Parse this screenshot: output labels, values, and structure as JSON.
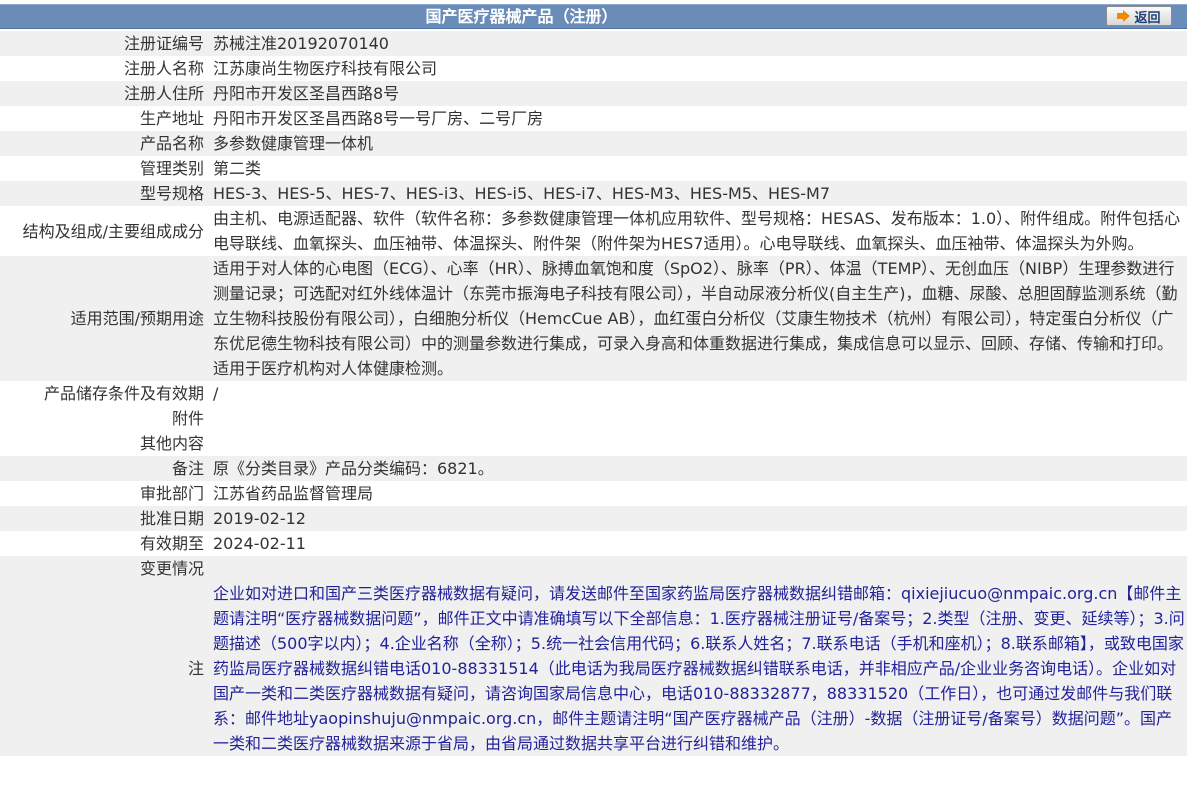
{
  "header": {
    "title": "国产医疗器械产品（注册）",
    "back_label": "返回"
  },
  "colors": {
    "title_bar": "#6a8cb8",
    "row_alt": "#f0f0f0",
    "back_arrow": "#f08a00",
    "note_text": "#22229a"
  },
  "rows": [
    {
      "label": "注册证编号",
      "value": "苏械注准20192070140"
    },
    {
      "label": "注册人名称",
      "value": "江苏康尚生物医疗科技有限公司"
    },
    {
      "label": "注册人住所",
      "value": "丹阳市开发区圣昌西路8号"
    },
    {
      "label": "生产地址",
      "value": "丹阳市开发区圣昌西路8号一号厂房、二号厂房"
    },
    {
      "label": "产品名称",
      "value": "多参数健康管理一体机"
    },
    {
      "label": "管理类别",
      "value": "第二类"
    },
    {
      "label": "型号规格",
      "value": "HES-3、HES-5、HES-7、HES-i3、HES-i5、HES-i7、HES-M3、HES-M5、HES-M7"
    },
    {
      "label": "结构及组成/主要组成成分",
      "value": "由主机、电源适配器、软件（软件名称：多参数健康管理一体机应用软件、型号规格：HESAS、发布版本：1.0）、附件组成。附件包括心电导联线、血氧探头、血压袖带、体温探头、附件架（附件架为HES7适用）。心电导联线、血氧探头、血压袖带、体温探头为外购。"
    },
    {
      "label": "适用范围/预期用途",
      "value": "适用于对人体的心电图（ECG）、心率（HR）、脉搏血氧饱和度（SpO2）、脉率（PR）、体温（TEMP）、无创血压（NIBP）生理参数进行测量记录；可选配对红外线体温计（东莞市振海电子科技有限公司），半自动尿液分析仪(自主生产)，血糖、尿酸、总胆固醇监测系统（勤立生物科技股份有限公司），白细胞分析仪（HemcCue AB），血红蛋白分析仪（艾康生物技术（杭州）有限公司），特定蛋白分析仪（广东优尼德生物科技有限公司）中的测量参数进行集成，可录入身高和体重数据进行集成，集成信息可以显示、回顾、存储、传输和打印。适用于医疗机构对人体健康检测。"
    },
    {
      "label": "产品储存条件及有效期",
      "value": "/"
    },
    {
      "label": "附件",
      "value": ""
    },
    {
      "label": "其他内容",
      "value": ""
    },
    {
      "label": "备注",
      "value": "原《分类目录》产品分类编码：6821。"
    },
    {
      "label": "审批部门",
      "value": "江苏省药品监督管理局"
    },
    {
      "label": "批准日期",
      "value": "2019-02-12"
    },
    {
      "label": "有效期至",
      "value": "2024-02-11"
    },
    {
      "label": "变更情况",
      "value": ""
    },
    {
      "label": "注",
      "value": "企业如对进口和国产三类医疗器械数据有疑问，请发送邮件至国家药监局医疗器械数据纠错邮箱：qixiejiucuo@nmpaic.org.cn【邮件主题请注明“医疗器械数据问题”，邮件正文中请准确填写以下全部信息：1.医疗器械注册证号/备案号；2.类型（注册、变更、延续等）；3.问题描述（500字以内）；4.企业名称（全称）；5.统一社会信用代码；6.联系人姓名；7.联系电话（手机和座机）；8.联系邮箱】，或致电国家药监局医疗器械数据纠错电话010-88331514（此电话为我局医疗器械数据纠错联系电话，并非相应产品/企业业务咨询电话）。企业如对国产一类和二类医疗器械数据有疑问，请咨询国家局信息中心，电话010-88332877，88331520（工作日），也可通过发邮件与我们联系：邮件地址yaopinshuju@nmpaic.org.cn，邮件主题请注明“国产医疗器械产品（注册）-数据（注册证号/备案号）数据问题”。国产一类和二类医疗器械数据来源于省局，由省局通过数据共享平台进行纠错和维护。"
    }
  ]
}
